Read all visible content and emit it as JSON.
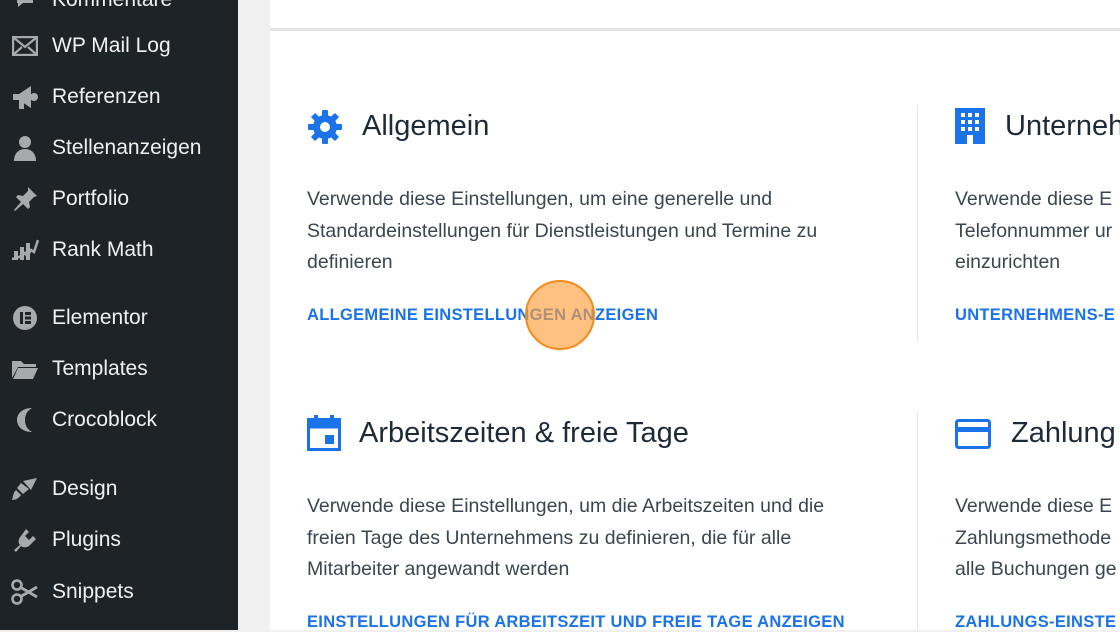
{
  "sidebar": {
    "items": [
      {
        "label": "Kommentare",
        "icon": "comment-icon"
      },
      {
        "label": "WP Mail Log",
        "icon": "mail-icon"
      },
      {
        "label": "Referenzen",
        "icon": "megaphone-icon"
      },
      {
        "label": "Stellenanzeigen",
        "icon": "user-icon"
      },
      {
        "label": "Portfolio",
        "icon": "pin-icon"
      },
      {
        "label": "Rank Math",
        "icon": "chart-icon"
      },
      {
        "label": "Elementor",
        "icon": "elementor-icon"
      },
      {
        "label": "Templates",
        "icon": "folder-icon"
      },
      {
        "label": "Crocoblock",
        "icon": "crocoblock-icon"
      },
      {
        "label": "Design",
        "icon": "brush-icon"
      },
      {
        "label": "Plugins",
        "icon": "plugin-icon"
      },
      {
        "label": "Snippets",
        "icon": "scissors-icon"
      }
    ]
  },
  "cards": {
    "general": {
      "title": "Allgemein",
      "description": "Verwende diese Einstellungen, um eine generelle und Standardeinstellungen für Dienstleistungen und Termine zu definieren",
      "link": "ALLGEMEINE EINSTELLUNGEN ANZEIGEN",
      "icon": "gear-icon"
    },
    "company": {
      "title": "Unterneh",
      "description": "Verwende diese E\nTelefonnummer ur\neinzurichten",
      "link": "UNTERNEHMENS-E",
      "icon": "building-icon"
    },
    "hours": {
      "title": "Arbeitszeiten & freie Tage",
      "description": "Verwende diese Einstellungen, um die Arbeitszeiten und die freien Tage des Unternehmens zu definieren, die für alle Mitarbeiter angewandt werden",
      "link": "EINSTELLUNGEN FÜR ARBEITSZEIT UND FREIE TAGE ANZEIGEN",
      "icon": "calendar-icon"
    },
    "payment": {
      "title": "Zahlung",
      "description": "Verwende diese E\nZahlungsmethode\nalle Buchungen ge",
      "link": "ZAHLUNGS-EINSTE",
      "icon": "credit-card-icon"
    }
  },
  "colors": {
    "sidebar_bg": "#1d2327",
    "accent": "#1a73e8",
    "click_marker": "#f28c1e"
  }
}
